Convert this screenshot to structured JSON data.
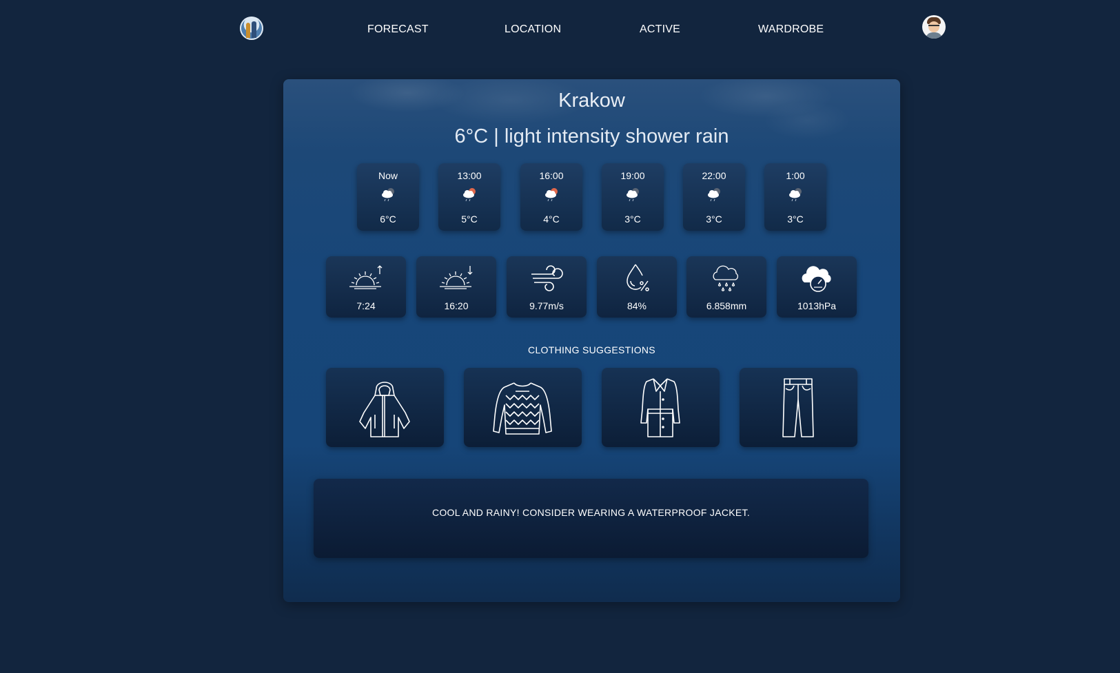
{
  "nav": {
    "links": [
      "FORECAST",
      "LOCATION",
      "ACTIVE",
      "WARDROBE"
    ]
  },
  "weather": {
    "city": "Krakow",
    "headline": "6°C | light intensity shower rain"
  },
  "hourly": [
    {
      "time": "Now",
      "temp": "6°C",
      "icon": "cloud-rain-night-icon"
    },
    {
      "time": "13:00",
      "temp": "5°C",
      "icon": "cloud-rain-sun-icon"
    },
    {
      "time": "16:00",
      "temp": "4°C",
      "icon": "cloud-rain-sun-icon"
    },
    {
      "time": "19:00",
      "temp": "3°C",
      "icon": "cloud-rain-night-icon"
    },
    {
      "time": "22:00",
      "temp": "3°C",
      "icon": "cloud-rain-night-icon"
    },
    {
      "time": "1:00",
      "temp": "3°C",
      "icon": "cloud-rain-night-icon"
    }
  ],
  "stats": [
    {
      "icon": "sunrise-icon",
      "value": "7:24"
    },
    {
      "icon": "sunset-icon",
      "value": "16:20"
    },
    {
      "icon": "wind-icon",
      "value": "9.77m/s"
    },
    {
      "icon": "humidity-icon",
      "value": "84%"
    },
    {
      "icon": "precipitation-icon",
      "value": "6.858mm"
    },
    {
      "icon": "pressure-icon",
      "value": "1013hPa"
    }
  ],
  "clothing": {
    "title": "CLOTHING SUGGESTIONS",
    "items": [
      "raincoat-icon",
      "sweater-icon",
      "coat-icon",
      "trousers-icon"
    ]
  },
  "advice": "COOL AND RAINY! CONSIDER WEARING A WATERPROOF JACKET.",
  "colors": {
    "page_bg": "#12253e",
    "card_bg": "#174679",
    "tile_bg": "#112a48",
    "sun_accent": "#e0684b"
  }
}
